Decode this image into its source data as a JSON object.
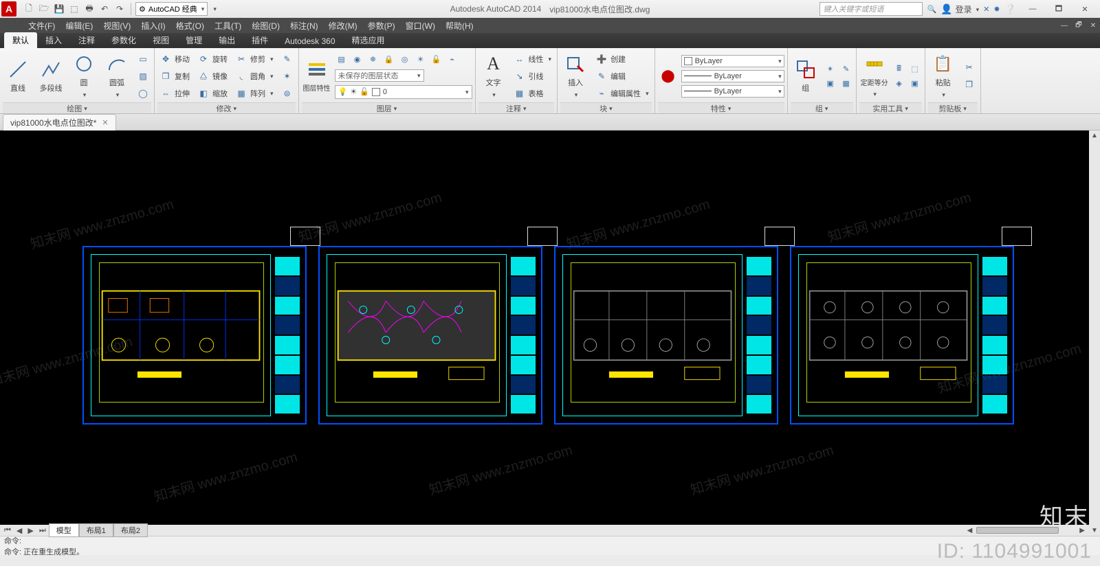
{
  "app": {
    "title_product": "Autodesk AutoCAD 2014",
    "title_file": "vip81000水电点位图改.dwg"
  },
  "qat": {
    "workspace": "AutoCAD 经典",
    "search_placeholder": "键入关键字或短语",
    "login": "登录"
  },
  "menu": [
    "文件(F)",
    "编辑(E)",
    "视图(V)",
    "插入(I)",
    "格式(O)",
    "工具(T)",
    "绘图(D)",
    "标注(N)",
    "修改(M)",
    "参数(P)",
    "窗口(W)",
    "帮助(H)"
  ],
  "ribbon_tabs": [
    "默认",
    "插入",
    "注释",
    "参数化",
    "视图",
    "管理",
    "输出",
    "插件",
    "Autodesk 360",
    "精选应用"
  ],
  "panel_draw": {
    "title": "绘图",
    "items": [
      "直线",
      "多段线",
      "圆",
      "圆弧"
    ]
  },
  "panel_modify": {
    "title": "修改",
    "rows": [
      [
        "移动",
        "旋转",
        "修剪"
      ],
      [
        "复制",
        "镜像",
        "圆角"
      ],
      [
        "拉伸",
        "缩放",
        "阵列"
      ]
    ]
  },
  "panel_layer": {
    "title": "图层",
    "big": "图层特性",
    "state": "未保存的图层状态",
    "current": "0"
  },
  "panel_anno": {
    "title": "注释",
    "big": "文字",
    "items": [
      "线性",
      "引线",
      "表格"
    ]
  },
  "panel_block": {
    "title": "块",
    "big": "插入",
    "items": [
      "创建",
      "编辑",
      "编辑属性"
    ]
  },
  "panel_props": {
    "title": "特性",
    "color": "ByLayer",
    "line1": "ByLayer",
    "line2": "ByLayer"
  },
  "panel_group": {
    "title": "组",
    "big": "组"
  },
  "panel_util": {
    "title": "实用工具",
    "item": "定距等分"
  },
  "panel_clip": {
    "title": "剪贴板",
    "big": "粘贴"
  },
  "doc_tab": "vip81000水电点位图改*",
  "layout_tabs": {
    "active": "模型",
    "others": [
      "布局1",
      "布局2"
    ]
  },
  "cmd": {
    "line1": "命令:",
    "line2": "命令: 正在重生成模型。"
  },
  "watermark": "知末网 www.znzmo.com",
  "brand_overlay": "知末",
  "id_overlay": "ID: 1104991001"
}
